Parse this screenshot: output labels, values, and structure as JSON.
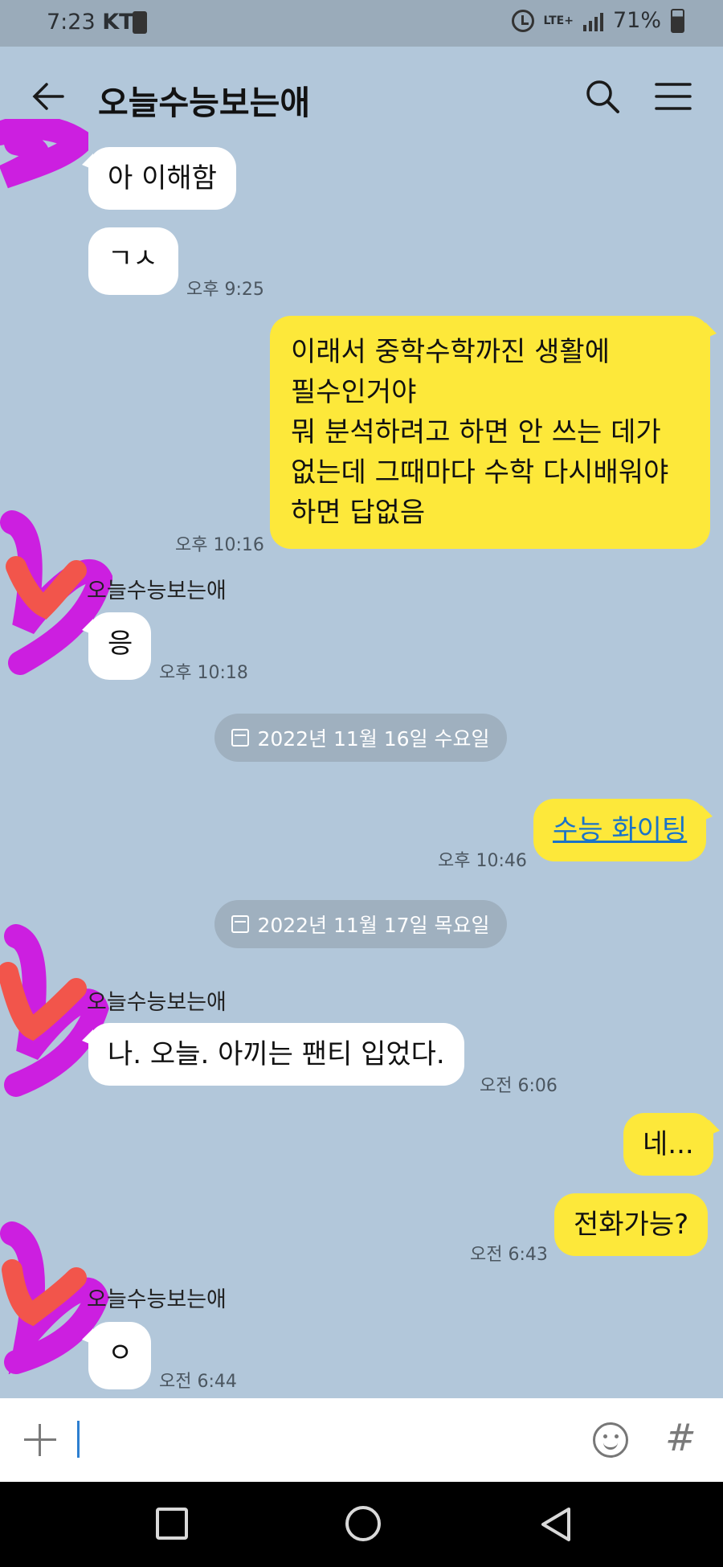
{
  "status_bar": {
    "time": "7:23",
    "carrier": "KT",
    "network": "LTE+",
    "battery": "71%"
  },
  "header": {
    "title": "오늘수능보는애"
  },
  "messages": {
    "m1": {
      "text": "아 이해함"
    },
    "m2": {
      "text": "ㄱㅅ",
      "time": "오후 9:25"
    },
    "m3": {
      "lines": [
        "이래서 중학수학까진 생활에",
        "필수인거야",
        "뭐 분석하려고 하면 안 쓰는 데가",
        "없는데 그때마다 수학 다시배워야",
        "하면 답없음"
      ],
      "time": "오후 10:16"
    },
    "m4": {
      "sender": "오늘수능보는애",
      "text": "응",
      "time": "오후 10:18"
    },
    "date1": "2022년 11월 16일 수요일",
    "m5": {
      "text": "수능 화이팅",
      "time": "오후 10:46"
    },
    "date2": "2022년 11월 17일 목요일",
    "m6": {
      "sender": "오늘수능보는애",
      "text": "나. 오늘. 아끼는 팬티 입었다.",
      "time": "오전 6:06"
    },
    "m7": {
      "text": "네..."
    },
    "m8": {
      "text": "전화가능?",
      "time": "오전 6:43"
    },
    "m9": {
      "sender": "오늘수능보는애",
      "text": "ㅇ",
      "time": "오전 6:44"
    }
  },
  "colors": {
    "background": "#b2c7da",
    "outgoing": "#fde83a",
    "incoming": "#ffffff",
    "scribble_purple": "#cc1fe0",
    "scribble_red": "#f2554b"
  },
  "icons": [
    "back-icon",
    "search-icon",
    "menu-icon",
    "calendar-icon",
    "plus-icon",
    "emoji-icon",
    "hash-icon"
  ]
}
